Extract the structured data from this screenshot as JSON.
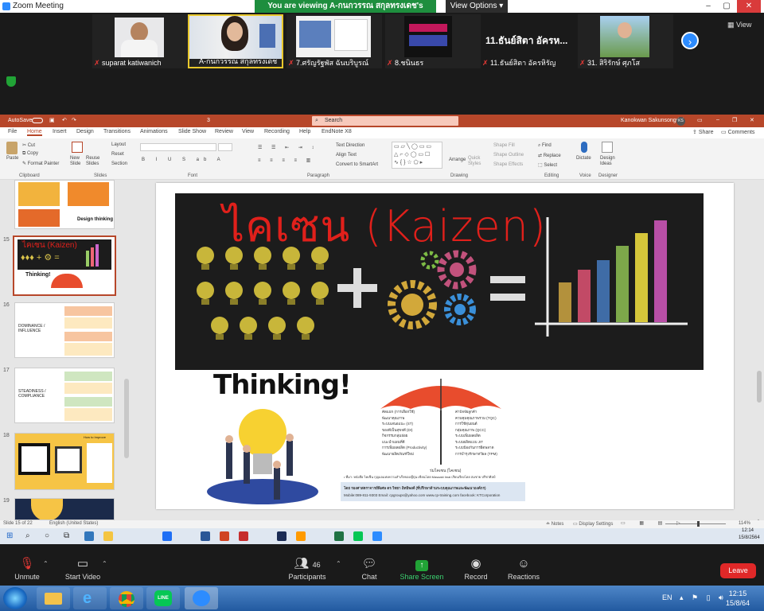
{
  "zoom": {
    "title": "Zoom Meeting",
    "viewing_banner": "You are viewing A-กนกวรรณ สกุลทรงเดช's screen",
    "view_options": "View Options",
    "view": "View",
    "participants": [
      {
        "name": "suparat katiwanich"
      },
      {
        "name": "A-กนกวรรณ สกุลทรงเดช"
      },
      {
        "name": "7.ศรัญรัฐพัส ฉันบริบูรณ์"
      },
      {
        "name": "8.ชนินธร"
      },
      {
        "name": "11.ธันย์สิตา อัครหิรัญ",
        "big": "11.ธันย์สิตา อัครห..."
      },
      {
        "name": "31. สิริรักษ์ ศุภโส"
      }
    ],
    "controls": {
      "unmute": "Unmute",
      "start_video": "Start Video",
      "participants": "Participants",
      "participant_count": "46",
      "chat": "Chat",
      "share_screen": "Share Screen",
      "record": "Record",
      "reactions": "Reactions",
      "leave": "Leave"
    }
  },
  "ppt": {
    "autosave": "AutoSave",
    "doc_number": "3",
    "search": "Search",
    "user": "Kanokwan Sakunsongdej",
    "user_initials": "KS",
    "tabs": [
      "File",
      "Home",
      "Insert",
      "Design",
      "Transitions",
      "Animations",
      "Slide Show",
      "Review",
      "View",
      "Recording",
      "Help",
      "EndNote X8"
    ],
    "share": "Share",
    "comments": "Comments",
    "ribbon": {
      "paste": "Paste",
      "cut": "Cut",
      "copy": "Copy",
      "format_painter": "Format Painter",
      "clipboard": "Clipboard",
      "new_slide": "New Slide",
      "reuse_slides": "Reuse Slides",
      "layout": "Layout",
      "reset": "Reset",
      "section": "Section",
      "slides": "Slides",
      "font": "Font",
      "paragraph": "Paragraph",
      "text_direction": "Text Direction",
      "align_text": "Align Text",
      "convert_smartart": "Convert to SmartArt",
      "arrange": "Arrange",
      "quick_styles": "Quick Styles",
      "shape_fill": "Shape Fill",
      "shape_outline": "Shape Outline",
      "shape_effects": "Shape Effects",
      "drawing": "Drawing",
      "find": "Find",
      "replace": "Replace",
      "select": "Select",
      "editing": "Editing",
      "dictate": "Dictate",
      "voice": "Voice",
      "design_ideas": "Design Ideas",
      "designer": "Designer"
    },
    "thumbnails": [
      {
        "num": "",
        "label": "Design thinking"
      },
      {
        "num": "15",
        "label": "ไคเซน (Kaizen)"
      },
      {
        "num": "16",
        "label": "DOMINANCE / INFLUENCE"
      },
      {
        "num": "17",
        "label": "STEADINESS / COMPLIANCE"
      },
      {
        "num": "18",
        "label": "How to Improve"
      },
      {
        "num": "19",
        "label": ""
      }
    ],
    "slide": {
      "title": "ไคเซน (Kaizen)",
      "thinking": "Thinking!",
      "umbrella_left": [
        "คัดแยก (การเลือกใช้)",
        "พัฒนาคุณภาพ",
        "ระบบเสนอแนะ (ST)",
        "ของดีเป็นสุขจดี (DI)",
        "กิจกรรมกลุ่มย่อย",
        "แนะนำแผนที่ดี",
        "การเพิ่มผลผลิต (Productivity)",
        "พัฒนาผลิตภัณฑ์ใหม่"
      ],
      "umbrella_right": [
        "ค่าปัจจัยลูกค้า",
        "ควบคุมคุณภาพรวม (TQC)",
        "การใช้หุ่นยนต์",
        "กลุ่มคุณภาพ (QCC)",
        "ระบบเพิ่มผลผลิต",
        "ระบบผลิตแบบ JIT",
        "ระบบป้องกันการผิดพลาด",
        "การบำรุงรักษาทวีผล (TPM)"
      ],
      "umbrella_caption": "ร่มไคเซน (ไคเซน)",
      "footnote": "• ที่มา: หนังสือ ไคเซ็น กุญแจแห่งความสำเร็จของญี่ปุ่น เขียนโดย Masaaki Imai  เรียบเรียงโดย สมชาย ปรีชาศิลป์",
      "footer": "โดย รองศาสตราจารย์พิเศษ ดร.วิทยา อิทธิพงศ์ (ที่ปรึกษาด้านระบบคุณภาพและพัฒนาองค์กร)",
      "footer2": "Mobile:089-811-9303  Email: cpgroups@yahoo.com  www.cp-training.com  facebook: KTCorporation"
    },
    "status": {
      "slide": "Slide 15 of 22",
      "lang": "English (United States)",
      "notes": "Notes",
      "display": "Display Settings",
      "zoom": "114%"
    }
  },
  "taskbar_remote": {
    "time": "12:14",
    "date": "15/8/2564"
  },
  "taskbar_local": {
    "lang": "EN",
    "time": "12:15",
    "date": "15/8/64"
  },
  "colors": {
    "kaizen_red": "#e0201b",
    "zoom_green": "#1e8e3e",
    "ppt_orange": "#b7472a",
    "leave_red": "#e02828",
    "zoom_blue": "#2d8cff"
  }
}
